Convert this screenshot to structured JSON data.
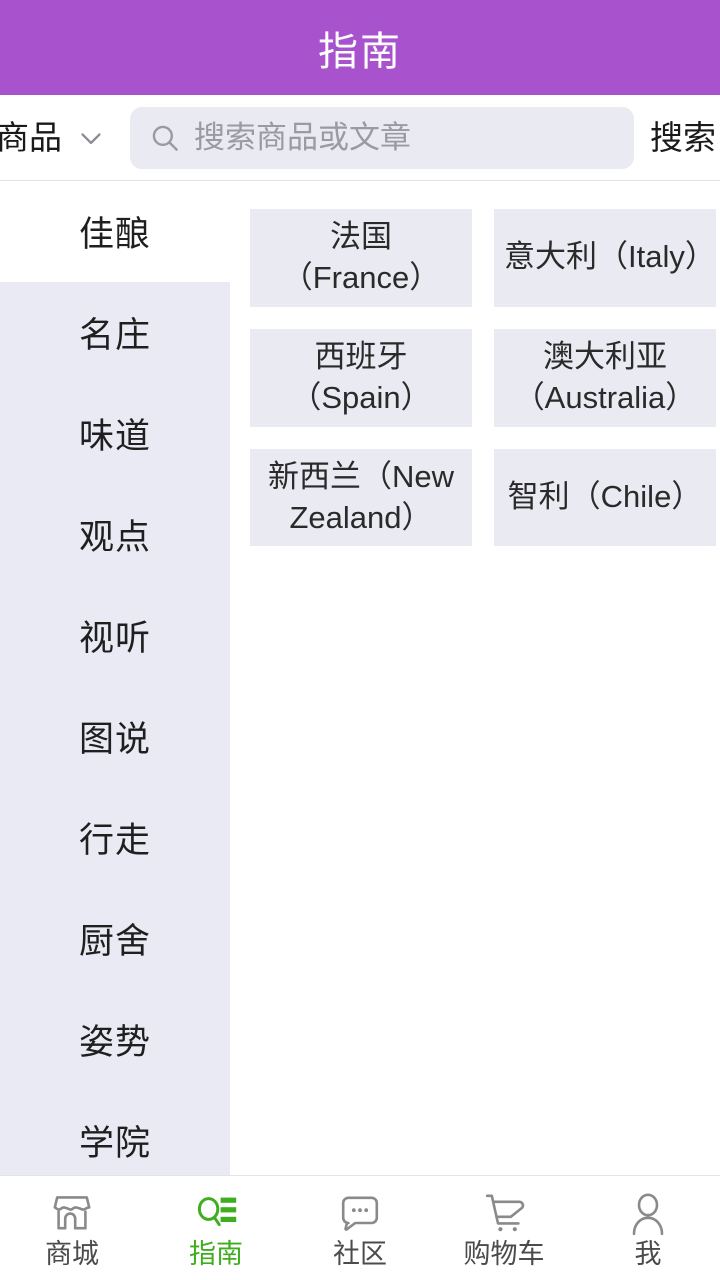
{
  "header": {
    "title": "指南",
    "background_color": "#a853cd",
    "title_color": "#ffffff"
  },
  "search": {
    "scope_label": "商品",
    "scope_chevron_icon": "chevron-down-icon",
    "icon": "search-icon",
    "value": "",
    "placeholder": "搜索商品或文章",
    "button_label": "搜索",
    "field_background": "#eaeaf2"
  },
  "sidebar": {
    "background_color": "#eaeaf4",
    "active_index": 0,
    "items": [
      {
        "label": "佳酿",
        "active": true
      },
      {
        "label": "名庄",
        "active": false
      },
      {
        "label": "味道",
        "active": false
      },
      {
        "label": "观点",
        "active": false
      },
      {
        "label": "视听",
        "active": false
      },
      {
        "label": "图说",
        "active": false
      },
      {
        "label": "行走",
        "active": false
      },
      {
        "label": "厨舍",
        "active": false
      },
      {
        "label": "姿势",
        "active": false
      },
      {
        "label": "学院",
        "active": false
      }
    ]
  },
  "content": {
    "tag_background": "#eaeaf2",
    "tags": [
      {
        "label": "法国（France）"
      },
      {
        "label": "意大利（Italy）"
      },
      {
        "label": "西班牙（Spain）"
      },
      {
        "label": "澳大利亚（Australia）"
      },
      {
        "label": "新西兰（New Zealand）"
      },
      {
        "label": "智利（Chile）"
      }
    ]
  },
  "tabbar": {
    "active_color": "#3fae1e",
    "inactive_color": "#4b4b4b",
    "tabs": [
      {
        "label": "商城",
        "icon": "store-icon",
        "active": false
      },
      {
        "label": "指南",
        "icon": "guide-search-list-icon",
        "active": true
      },
      {
        "label": "社区",
        "icon": "chat-bubble-icon",
        "active": false
      },
      {
        "label": "购物车",
        "icon": "shopping-cart-icon",
        "active": false
      },
      {
        "label": "我",
        "icon": "person-icon",
        "active": false
      }
    ]
  }
}
